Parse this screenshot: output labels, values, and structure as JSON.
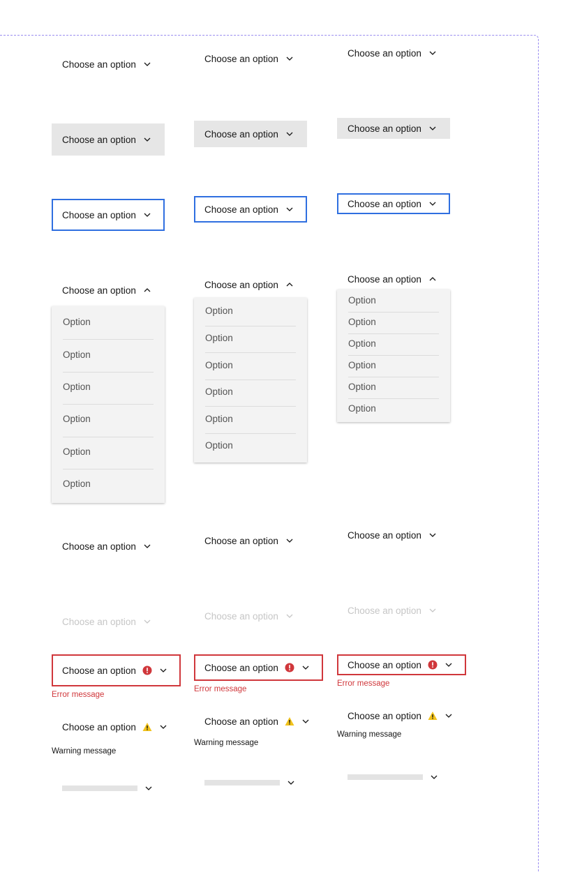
{
  "label": "Choose an option",
  "option_label": "Option",
  "error_message": "Error message",
  "warning_message": "Warning message",
  "colors": {
    "focus_border": "#2f6fe0",
    "error": "#d0373b",
    "warning": "#f1c21b",
    "hover_bg": "#e6e6e6",
    "menu_bg": "#f3f3f3",
    "frame_dash": "#9a8df0"
  },
  "sizes": [
    "large",
    "medium",
    "small"
  ],
  "states": [
    "default",
    "hover",
    "focus",
    "open",
    "selected",
    "disabled",
    "error",
    "warning",
    "skeleton"
  ],
  "icons": {
    "chevron_down": "chevron-down-icon",
    "chevron_up": "chevron-up-icon",
    "error": "error-filled-icon",
    "warning": "warning-filled-icon"
  }
}
